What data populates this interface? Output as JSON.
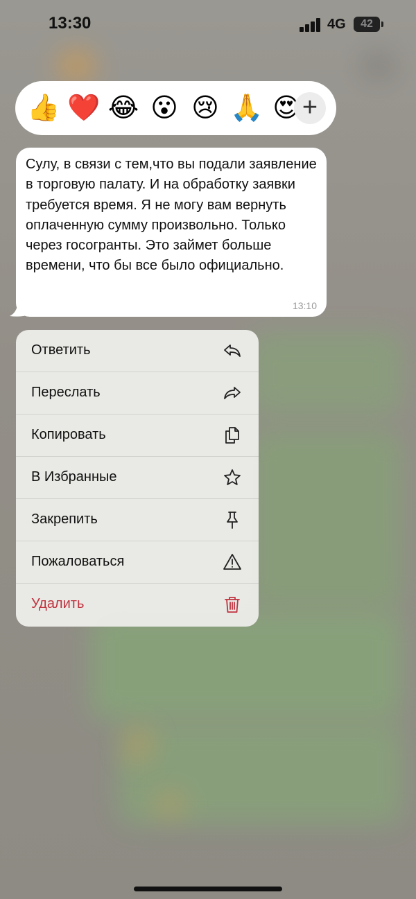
{
  "status_bar": {
    "time": "13:30",
    "network": "4G",
    "battery": "42"
  },
  "reactions": [
    {
      "emoji": "👍",
      "name": "thumbs-up"
    },
    {
      "emoji": "❤️",
      "name": "heart"
    },
    {
      "emoji": "😂",
      "name": "laughing"
    },
    {
      "emoji": "😮",
      "name": "surprised"
    },
    {
      "emoji": "😢",
      "name": "crying"
    },
    {
      "emoji": "🙏",
      "name": "pray"
    },
    {
      "emoji": "😍",
      "name": "heart-eyes"
    }
  ],
  "add_reaction_label": "+",
  "message": {
    "text": "Сулу, в связи с тем,что вы подали заявление в торговую палату. И на обработку заявки требуется время. Я не могу вам вернуть оплаченную сумму произвольно. Только через госогранты. Это займет больше времени, что бы все было официально.",
    "time": "13:10"
  },
  "menu": {
    "items": [
      {
        "label": "Ответить",
        "icon": "reply-icon"
      },
      {
        "label": "Переслать",
        "icon": "forward-icon"
      },
      {
        "label": "Копировать",
        "icon": "copy-icon"
      },
      {
        "label": "В Избранные",
        "icon": "star-icon"
      },
      {
        "label": "Закрепить",
        "icon": "pin-icon"
      },
      {
        "label": "Пожаловаться",
        "icon": "warning-icon"
      },
      {
        "label": "Удалить",
        "icon": "trash-icon"
      }
    ]
  },
  "colors": {
    "danger": "#c0333f",
    "text": "#111111"
  }
}
